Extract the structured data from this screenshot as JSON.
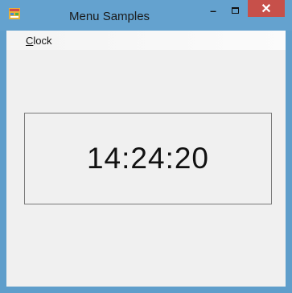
{
  "window": {
    "title": "Menu Samples",
    "minimize_glyph": "–",
    "close_glyph": "✕"
  },
  "menu": {
    "items": [
      {
        "label_first": "C",
        "label_rest": "lock"
      }
    ]
  },
  "clock": {
    "time": "14:24:20"
  },
  "colors": {
    "titlebar": "#64a2cf",
    "close_button": "#c7504a",
    "client_background": "#f0f0f0"
  }
}
